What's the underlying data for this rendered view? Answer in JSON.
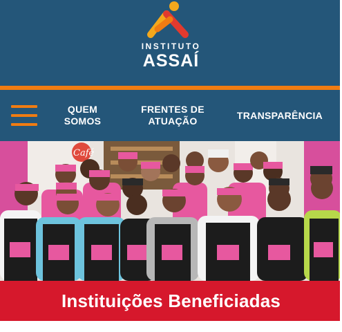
{
  "logo": {
    "line1": "INSTITUTO",
    "line2": "ASSAÍ",
    "colors": {
      "orange": "#f07c12",
      "red": "#e23a2e",
      "yellow": "#f4a81c"
    }
  },
  "nav": {
    "menu_icon": "hamburger-menu-icon",
    "items": [
      {
        "line1": "QUEM",
        "line2": "SOMOS"
      },
      {
        "line1": "FRENTES DE",
        "line2": "ATUAÇÃO"
      },
      {
        "line1": "TRANSPARÊNCIA",
        "line2": ""
      }
    ]
  },
  "photo": {
    "sign_text": "Café"
  },
  "banner": {
    "title": "Instituições Beneficiadas"
  },
  "colors": {
    "header_blue": "#245679",
    "accent_orange": "#f07c12",
    "banner_red": "#d6182c"
  }
}
